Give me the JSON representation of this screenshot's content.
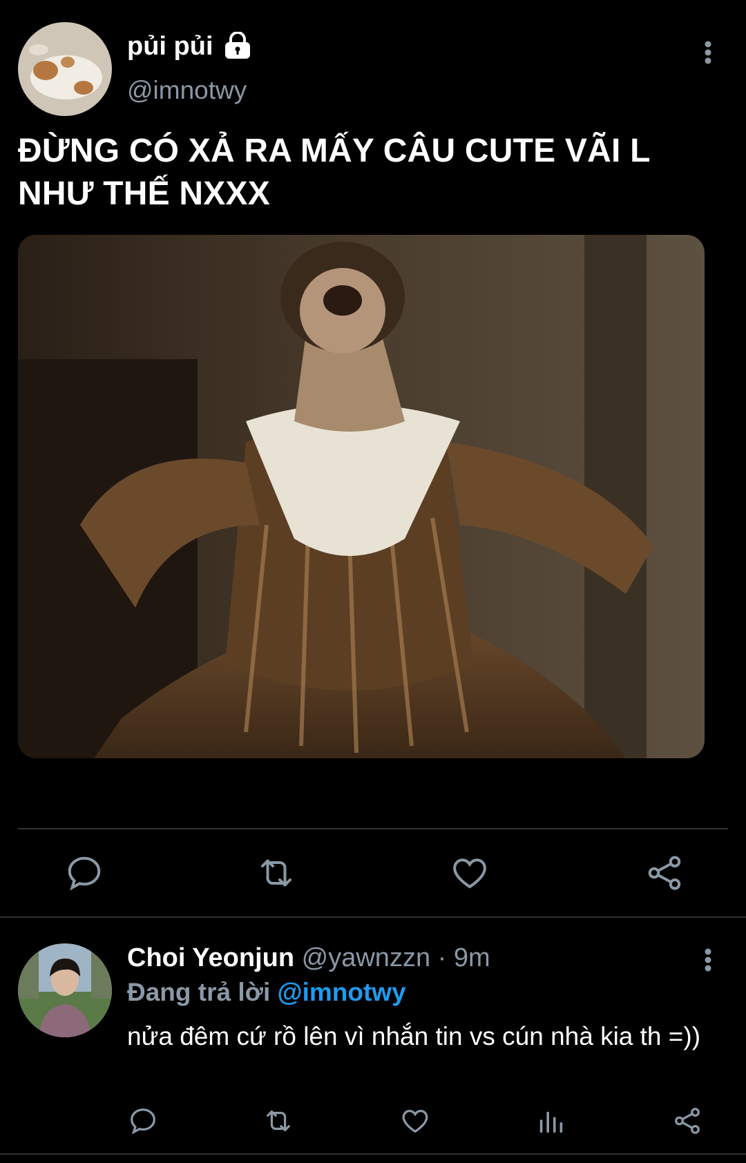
{
  "tweet": {
    "author": {
      "display_name": "pủi pủi",
      "handle": "@imnotwy",
      "locked_icon": "lock-icon"
    },
    "text": "ĐỪNG CÓ XẢ RA MẤY CÂU CUTE VÃI L NHƯ THẾ NXXX",
    "actions": [
      "reply-icon",
      "retweet-icon",
      "like-icon",
      "share-icon"
    ]
  },
  "reply": {
    "author": {
      "display_name": "Choi Yeonjun",
      "handle": "@yawnzzn",
      "separator": "·",
      "time": "9m"
    },
    "replying_label": "Đang trả lời",
    "replying_to": "@imnotwy",
    "text": "nửa đêm cứ rồ lên vì nhắn tin vs cún nhà kia th =))",
    "actions": [
      "reply-icon",
      "retweet-icon",
      "like-icon",
      "analytics-icon",
      "share-icon"
    ]
  },
  "colors": {
    "background": "#000000",
    "secondary_text": "#8b98a5",
    "link": "#1d9bf0",
    "divider": "#2f3336"
  }
}
